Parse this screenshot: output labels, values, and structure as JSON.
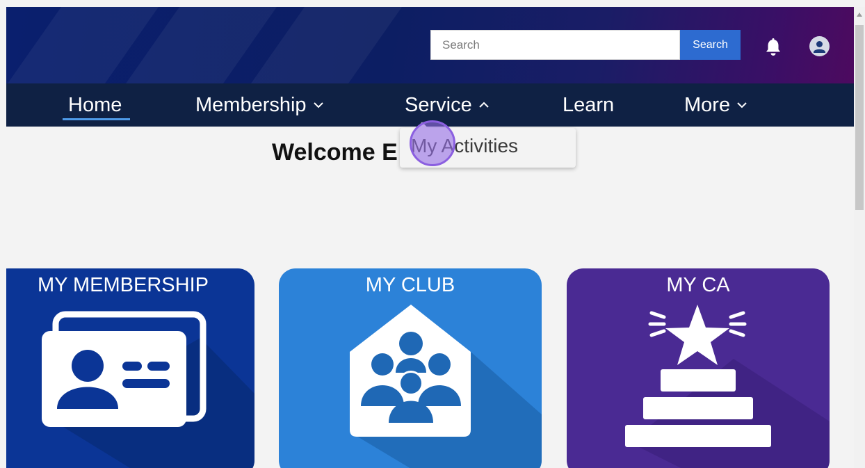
{
  "header": {
    "search_placeholder": "Search",
    "search_button": "Search",
    "bell_icon": "bell-icon",
    "avatar_icon": "user-avatar-icon",
    "gradient_colors": [
      "#0a1f6e",
      "#4d0a5f"
    ]
  },
  "nav": {
    "items": [
      {
        "label": "Home",
        "active": true,
        "chevron": "none"
      },
      {
        "label": "Membership",
        "chevron": "down"
      },
      {
        "label": "Service",
        "chevron": "up"
      },
      {
        "label": "Learn",
        "chevron": "none"
      },
      {
        "label": "More",
        "chevron": "down"
      }
    ],
    "background": "#0f2144",
    "active_underline_color": "#4e9ae8"
  },
  "dropdown": {
    "items": [
      {
        "label": "My Activities"
      }
    ]
  },
  "welcome": {
    "text": "Welcome E"
  },
  "tiles": [
    {
      "title": "MY MEMBERSHIP",
      "icon": "id-card-icon",
      "color": "#0b3596"
    },
    {
      "title": "MY CLUB",
      "icon": "club-group-icon",
      "color": "#2c82d8"
    },
    {
      "title": "MY CA",
      "icon": "star-podium-icon",
      "color": "#4a2a93"
    }
  ]
}
